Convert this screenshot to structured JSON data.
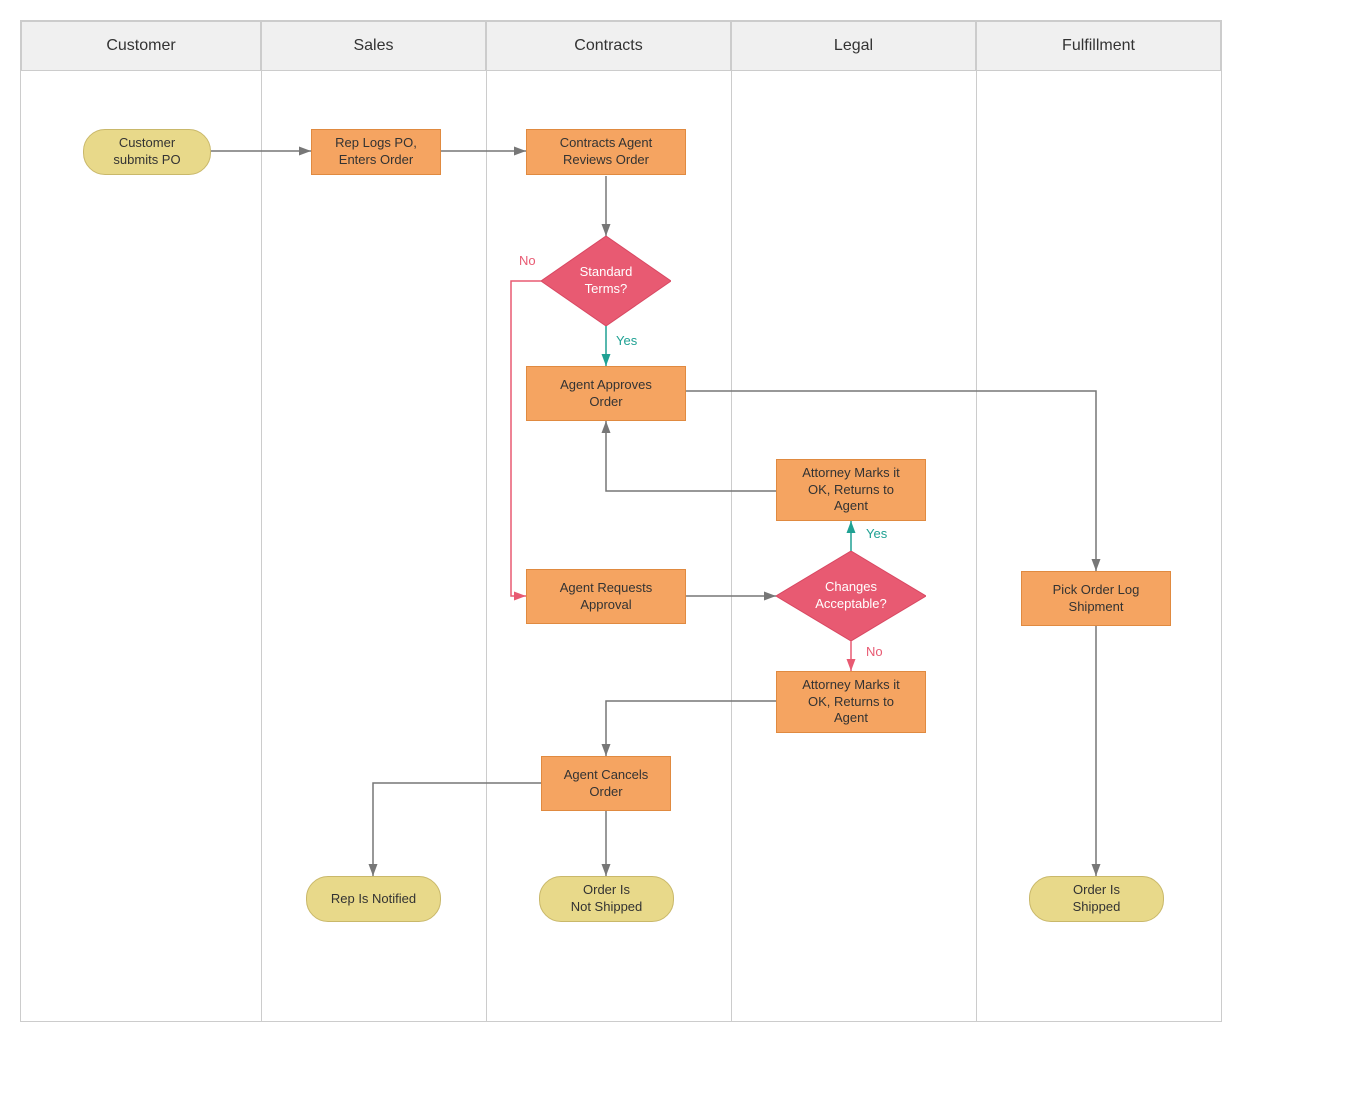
{
  "lanes": [
    {
      "id": "customer",
      "label": "Customer"
    },
    {
      "id": "sales",
      "label": "Sales"
    },
    {
      "id": "contracts",
      "label": "Contracts"
    },
    {
      "id": "legal",
      "label": "Legal"
    },
    {
      "id": "fulfillment",
      "label": "Fulfillment"
    }
  ],
  "nodes": {
    "start": {
      "label": "Customer\nsubmits PO"
    },
    "repLogs": {
      "label": "Rep Logs PO,\nEnters Order"
    },
    "reviews": {
      "label": "Contracts Agent\nReviews Order"
    },
    "stdTerms": {
      "label": "Standard\nTerms?"
    },
    "approves": {
      "label": "Agent Approves\nOrder"
    },
    "attOk": {
      "label": "Attorney Marks it\nOK, Returns to\nAgent"
    },
    "requests": {
      "label": "Agent Requests\nApproval"
    },
    "changes": {
      "label": "Changes\nAcceptable?"
    },
    "attNo": {
      "label": "Attorney Marks it\nOK, Returns to\nAgent"
    },
    "cancels": {
      "label": "Agent Cancels\nOrder"
    },
    "repNotified": {
      "label": "Rep Is Notified"
    },
    "notShipped": {
      "label": "Order Is\nNot Shipped"
    },
    "pickOrder": {
      "label": "Pick Order Log\nShipment"
    },
    "shipped": {
      "label": "Order Is\nShipped"
    }
  },
  "edgeLabels": {
    "yes1": "Yes",
    "no1": "No",
    "yes2": "Yes",
    "no2": "No"
  },
  "colors": {
    "terminator": "#e8d98a",
    "process": "#f5a461",
    "decision": "#e85a72",
    "teal": "#1fa193",
    "pink": "#e85a72",
    "gray": "#777"
  }
}
